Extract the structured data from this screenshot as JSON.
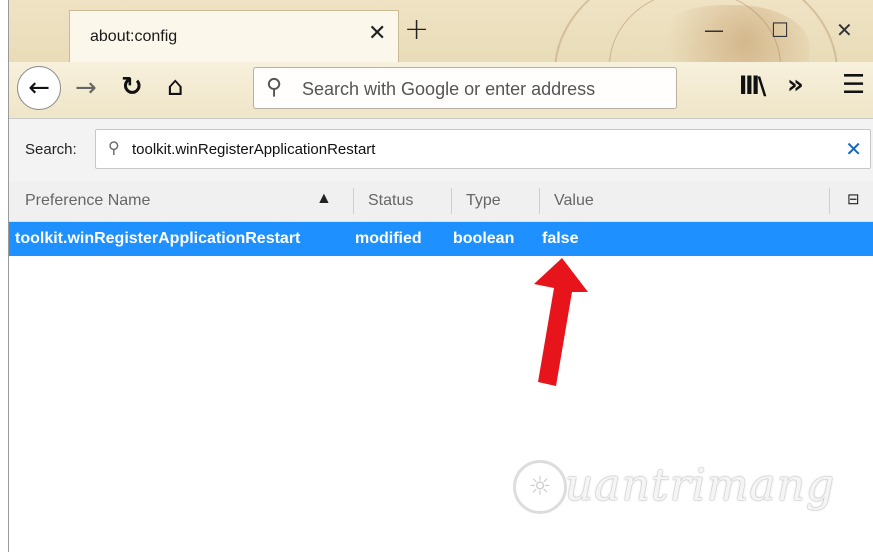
{
  "browser": {
    "tab": {
      "title": "about:config",
      "close_icon": "close-icon"
    },
    "new_tab_icon": "plus-icon",
    "window_controls": [
      "minimize-icon",
      "maximize-icon",
      "close-icon"
    ],
    "urlbar": {
      "placeholder": "Search with Google or enter address",
      "icon": "search-icon"
    },
    "nav_icons": [
      "back-arrow-icon",
      "forward-arrow-icon",
      "reload-icon",
      "home-icon",
      "library-icon",
      "overflow-chevron-icon",
      "hamburger-menu-icon"
    ]
  },
  "config": {
    "search_label": "Search:",
    "search_value": "toolkit.winRegisterApplicationRestart",
    "columns": {
      "name": "Preference Name",
      "status": "Status",
      "type": "Type",
      "value": "Value"
    },
    "rows": [
      {
        "name": "toolkit.winRegisterApplicationRestart",
        "status": "modified",
        "type": "boolean",
        "value": "false",
        "selected": true
      }
    ]
  },
  "annotation": {
    "arrow_color": "#e8141b"
  },
  "colors": {
    "selection": "#1e90ff",
    "clear_button": "#1565c0"
  }
}
